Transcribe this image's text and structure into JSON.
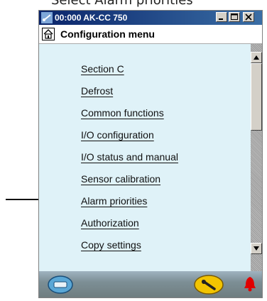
{
  "caption": "Select Alarm priorities",
  "window": {
    "title": "00:000 AK-CC 750",
    "header_title": "Configuration menu"
  },
  "menu": {
    "items": [
      {
        "label": "Section C"
      },
      {
        "label": "Defrost"
      },
      {
        "label": "Common functions"
      },
      {
        "label": "I/O configuration"
      },
      {
        "label": "I/O status and manual"
      },
      {
        "label": "Sensor calibration"
      },
      {
        "label": "Alarm priorities"
      },
      {
        "label": "Authorization"
      },
      {
        "label": "Copy settings"
      }
    ]
  },
  "icons": {
    "app": "meter-icon",
    "home": "home-icon",
    "footer_left": "card-icon",
    "footer_middle": "wrench-icon",
    "footer_right": "alarm-bell-icon"
  },
  "colors": {
    "titlebar": "#0a246a",
    "content_bg": "#dff2f8",
    "alarm": "#e00000",
    "wrench_button": "#f2c400"
  }
}
